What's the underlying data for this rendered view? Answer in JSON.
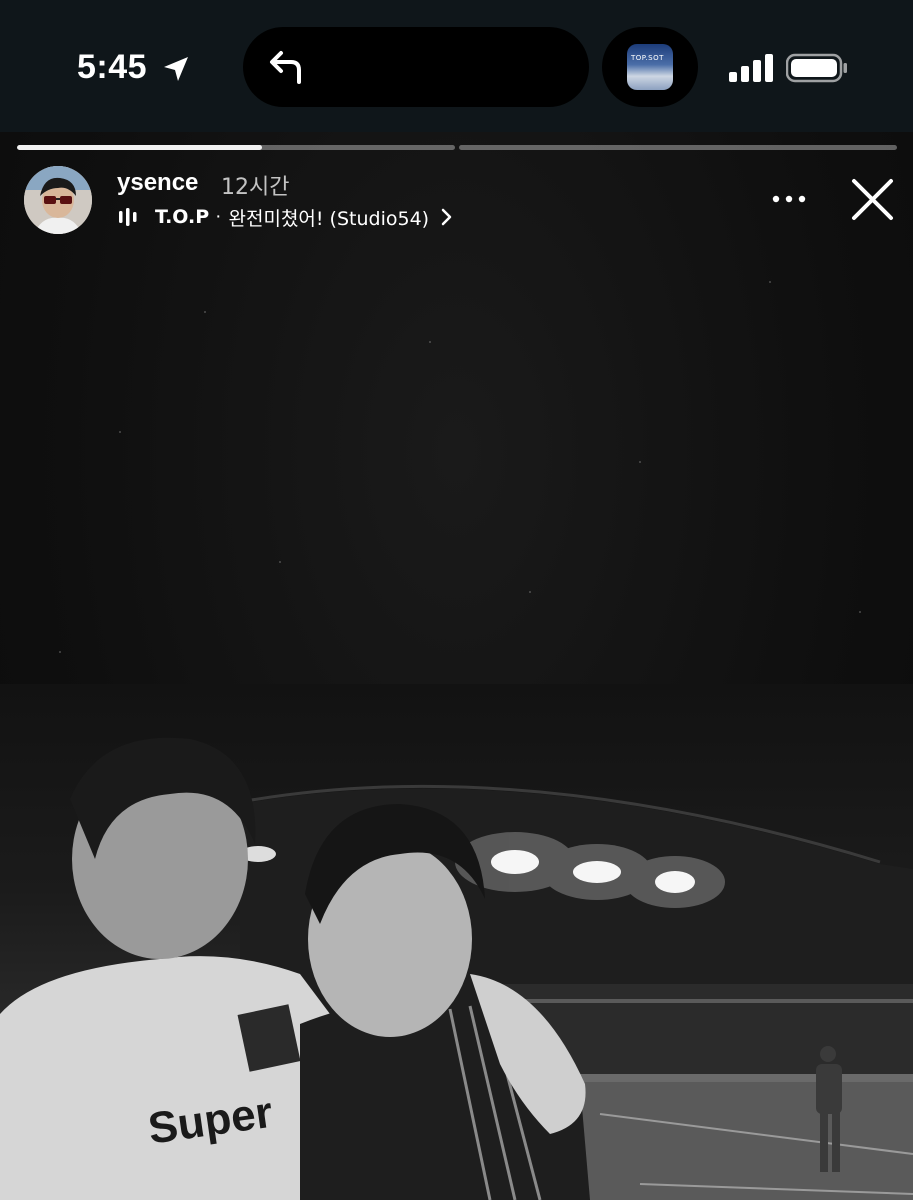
{
  "status_bar": {
    "time": "5:45",
    "icons": [
      "location-arrow-icon",
      "back-arrow-icon",
      "signal-icon",
      "battery-icon"
    ],
    "island_app_icon": "app-thumbnail",
    "island_app_thumb_text": "TOP.SOT"
  },
  "story": {
    "segments": [
      {
        "progress": 0.56
      },
      {
        "progress": 0.0
      }
    ],
    "username": "ysence",
    "time_ago": "12시간",
    "music": {
      "icon": "audio-bars-icon",
      "artist": "T.O.P",
      "separator": "·",
      "song": "완전미쳤어! (Studio54)"
    },
    "more_icon": "more-dots-icon",
    "close_icon": "close-icon"
  },
  "photo": {
    "jersey_text": "Super",
    "description_colors": {
      "top_background": "#0f0f0f",
      "ui_bar": "#0f161a"
    }
  }
}
